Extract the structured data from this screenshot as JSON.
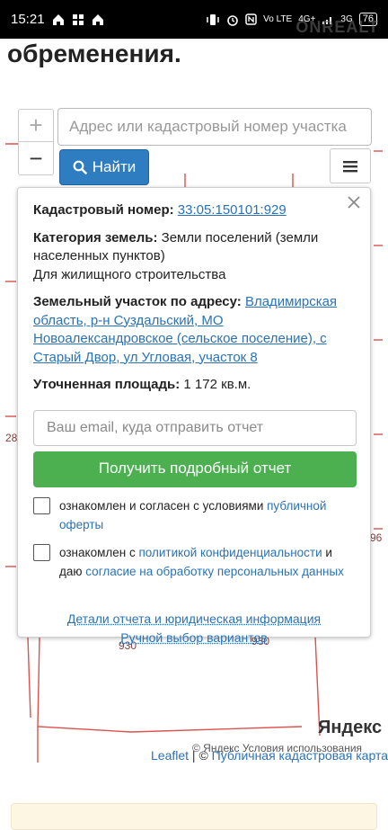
{
  "status_bar": {
    "time": "15:21",
    "battery": "76",
    "network_label": "4G+",
    "signal_label": "3G",
    "volte_label": "Vo LTE",
    "watermark": "ONREALT"
  },
  "page": {
    "heading": "обременения."
  },
  "map": {
    "zoom_in": "+",
    "zoom_out": "−",
    "search_placeholder": "Адрес или кадастровый номер участка",
    "find_button": "Найти",
    "numbers": [
      "28",
      "96",
      "930",
      "930"
    ],
    "provider_logo": "Яндекс",
    "copyright": "© Яндекс  Условия использования",
    "attribution_leaflet": "Leaflet",
    "attribution_sep": " | © ",
    "attribution_link": "Публичная кадастровая карта",
    "line_color": "#d9534f"
  },
  "popup": {
    "cadastral_label": "Кадастровый номер:",
    "cadastral_value": "33:05:150101:929",
    "category_label": "Категория земель:",
    "category_value": "Земли поселений (земли населенных пунктов)",
    "usage": "Для жилищного строительства",
    "address_label": "Земельный участок по адресу:",
    "address_value": "Владимирская область, р-н Суздальский, МО Новоалександровское (сельское поселение), с Старый Двор, ул Угловая, участок 8",
    "area_label": "Уточненная площадь:",
    "area_value": "1 172 кв.м.",
    "email_placeholder": "Ваш email, куда отправить отчет",
    "get_report_button": "Получить подробный отчет",
    "consent1_text": "ознакомлен и согласен с условиями",
    "consent1_link": "публичной оферты",
    "consent2_text": "ознакомлен с",
    "consent2_link": "политикой конфиденциальности",
    "consent2_and": "и даю",
    "consent2_link2": "согласие на обработку персональных данных",
    "details_link": "Детали отчета и юридическая информация",
    "manual_link": "Ручной выбор вариантов",
    "accent": "#2a72b5",
    "button_color": "#4caf50"
  }
}
